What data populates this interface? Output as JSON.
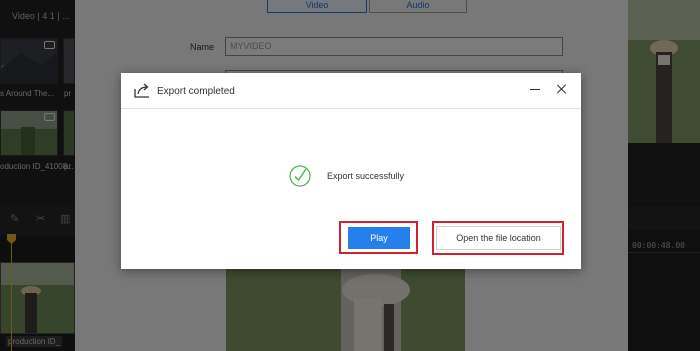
{
  "app": {
    "media_tab": "Video | 4 1 | ...",
    "thumbnails": [
      {
        "label": ""
      },
      {
        "label": "s Around The..."
      },
      {
        "label": "pr"
      },
      {
        "label": "oduction ID_41008..."
      },
      {
        "label": "pr"
      }
    ],
    "timeline": {
      "clip_label": "production ID_"
    },
    "preview": {
      "time_code": "00:00:48.00"
    }
  },
  "export_settings": {
    "tabs": [
      "Video",
      "Audio"
    ],
    "name_label": "Name",
    "name_value": "MYVIDEO"
  },
  "dialog": {
    "title": "Export completed",
    "icons": {
      "title": "export-icon",
      "success": "check-circle-icon",
      "minimize": "minimize-icon",
      "close": "close-icon"
    },
    "message": "Export successfully",
    "play_label": "Play",
    "open_location_label": "Open the file location",
    "colors": {
      "primary": "#2680eb",
      "success": "#46b649",
      "highlight": "#d3202a"
    }
  }
}
